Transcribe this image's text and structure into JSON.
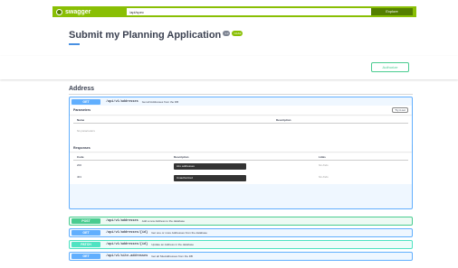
{
  "topbar": {
    "logo_text": "swagger",
    "url_value": "/api/spec",
    "explore_label": "Explore"
  },
  "info": {
    "title": "Submit my Planning Application",
    "version_badge": "1.0",
    "oas_badge": "OAS3"
  },
  "authorize_label": "Authorize",
  "section": {
    "title": "Address"
  },
  "colors": {
    "topbar": "#89bf04",
    "get": "#61affe",
    "post": "#49cc90",
    "patch": "#50e3c2"
  },
  "expanded_op": {
    "method": "GET",
    "path": "/api/v1/addresses",
    "description": "Get all Addresses from the DB",
    "parameters_label": "Parameters",
    "try_label": "Try it out",
    "param_col_name": "Name",
    "param_col_desc": "Description",
    "no_params": "No parameters",
    "responses_label": "Responses",
    "resp_col_code": "Code",
    "resp_col_desc": "Description",
    "resp_col_links": "Links",
    "responses": [
      {
        "code": "200",
        "description": "ALL addresses",
        "links": "No links"
      },
      {
        "code": "401",
        "description": "Unauthorized",
        "links": "No links"
      }
    ]
  },
  "operations": [
    {
      "method": "POST",
      "path": "/api/v1/addresses",
      "description": "Add a new Address to the database"
    },
    {
      "method": "GET",
      "path": "/api/v1/addresses/{id}",
      "description": "Get one or more Addresses from the database"
    },
    {
      "method": "PATCH",
      "path": "/api/v1/addresses/{id}",
      "description": "Update an Address in the database"
    },
    {
      "method": "GET",
      "path": "/api/v1/site-addresses",
      "description": "Get all SiteAddresses from the DB"
    }
  ]
}
